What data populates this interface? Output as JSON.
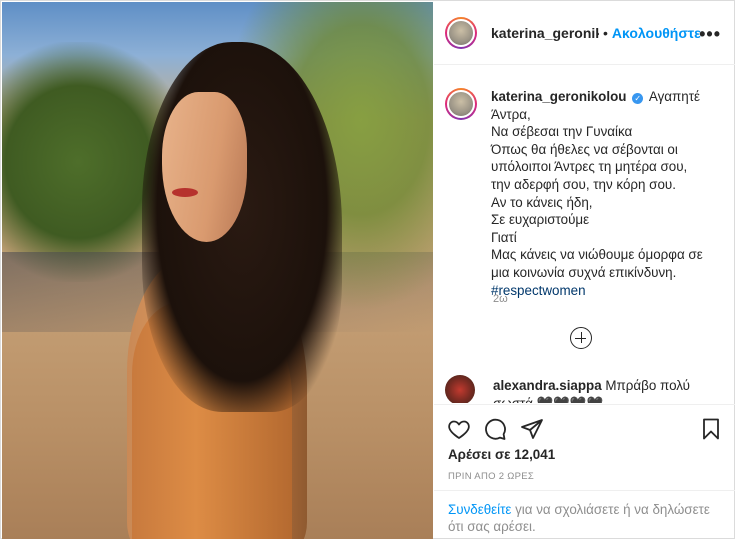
{
  "post": {
    "username": "katerina_geronikolou",
    "header_username": "katerina_geronikolou",
    "follow_label": "Ακολουθήστε",
    "more_label": "•••",
    "caption_lines": [
      "Αγαπητέ",
      "Άντρα,",
      "Να σέβεσαι την Γυναίκα",
      "Όπως θα ήθελες να σέβονται οι",
      "υπόλοιποι Άντρες τη μητέρα σου,",
      "την αδερφή σου, την κόρη σου.",
      "Αν το κάνεις ήδη,",
      "Σε ευχαριστούμε",
      "Γιατί",
      "Μας κάνεις να νιώθουμε όμορφα σε",
      "μια κοινωνία συχνά επικίνδυνη."
    ],
    "hashtag": "#respectwomen",
    "time": "2ω"
  },
  "comment": {
    "username": "alexandra.siappa",
    "text_line1": "Μπράβο πολύ",
    "text_line2": "σωστά 🖤🖤🖤🖤"
  },
  "engagement": {
    "likes": "Αρέσει σε 12,041",
    "posted_ago": "ΠΡΙΝ ΑΠΟ 2 ΩΡΕΣ"
  },
  "login_prompt": {
    "link": "Συνδεθείτε",
    "rest": " για να σχολιάσετε ή να δηλώσετε ότι σας αρέσει."
  },
  "icons": [
    "heart-icon",
    "comment-icon",
    "share-icon",
    "bookmark-icon",
    "plus-circle-icon",
    "verified-badge-icon"
  ],
  "colors": {
    "link": "#0095f6",
    "hashtag": "#00376b",
    "verified": "#3897f0",
    "muted": "#8e8e8e"
  }
}
